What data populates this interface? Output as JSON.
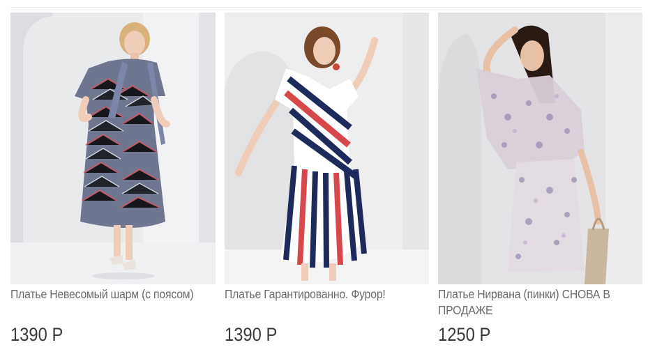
{
  "products": [
    {
      "title": "Платье Невесомый шарм (с поясом)",
      "price": "1390 Р",
      "colors": {
        "bg": "#e9eaec",
        "dress": "#6f7690",
        "accent": "#c75a63",
        "skin": "#efcdb8",
        "hair": "#d8b27a"
      }
    },
    {
      "title": "Платье Гарантированно. Фурор!",
      "price": "1390 Р",
      "colors": {
        "bg": "#eeeeef",
        "navy": "#1f2a5c",
        "red": "#d6484a",
        "white": "#ffffff",
        "skin": "#efcdb8",
        "hair": "#7a4a2a"
      }
    },
    {
      "title": "Платье Нирвана (пинки) СНОВА В ПРОДАЖЕ",
      "price": "1250 Р",
      "colors": {
        "bg": "#e4e4e6",
        "dress": "#d9cfd8",
        "print": "#9b8fb0",
        "skin": "#e8c0a6",
        "hair": "#2a1a14"
      }
    }
  ]
}
